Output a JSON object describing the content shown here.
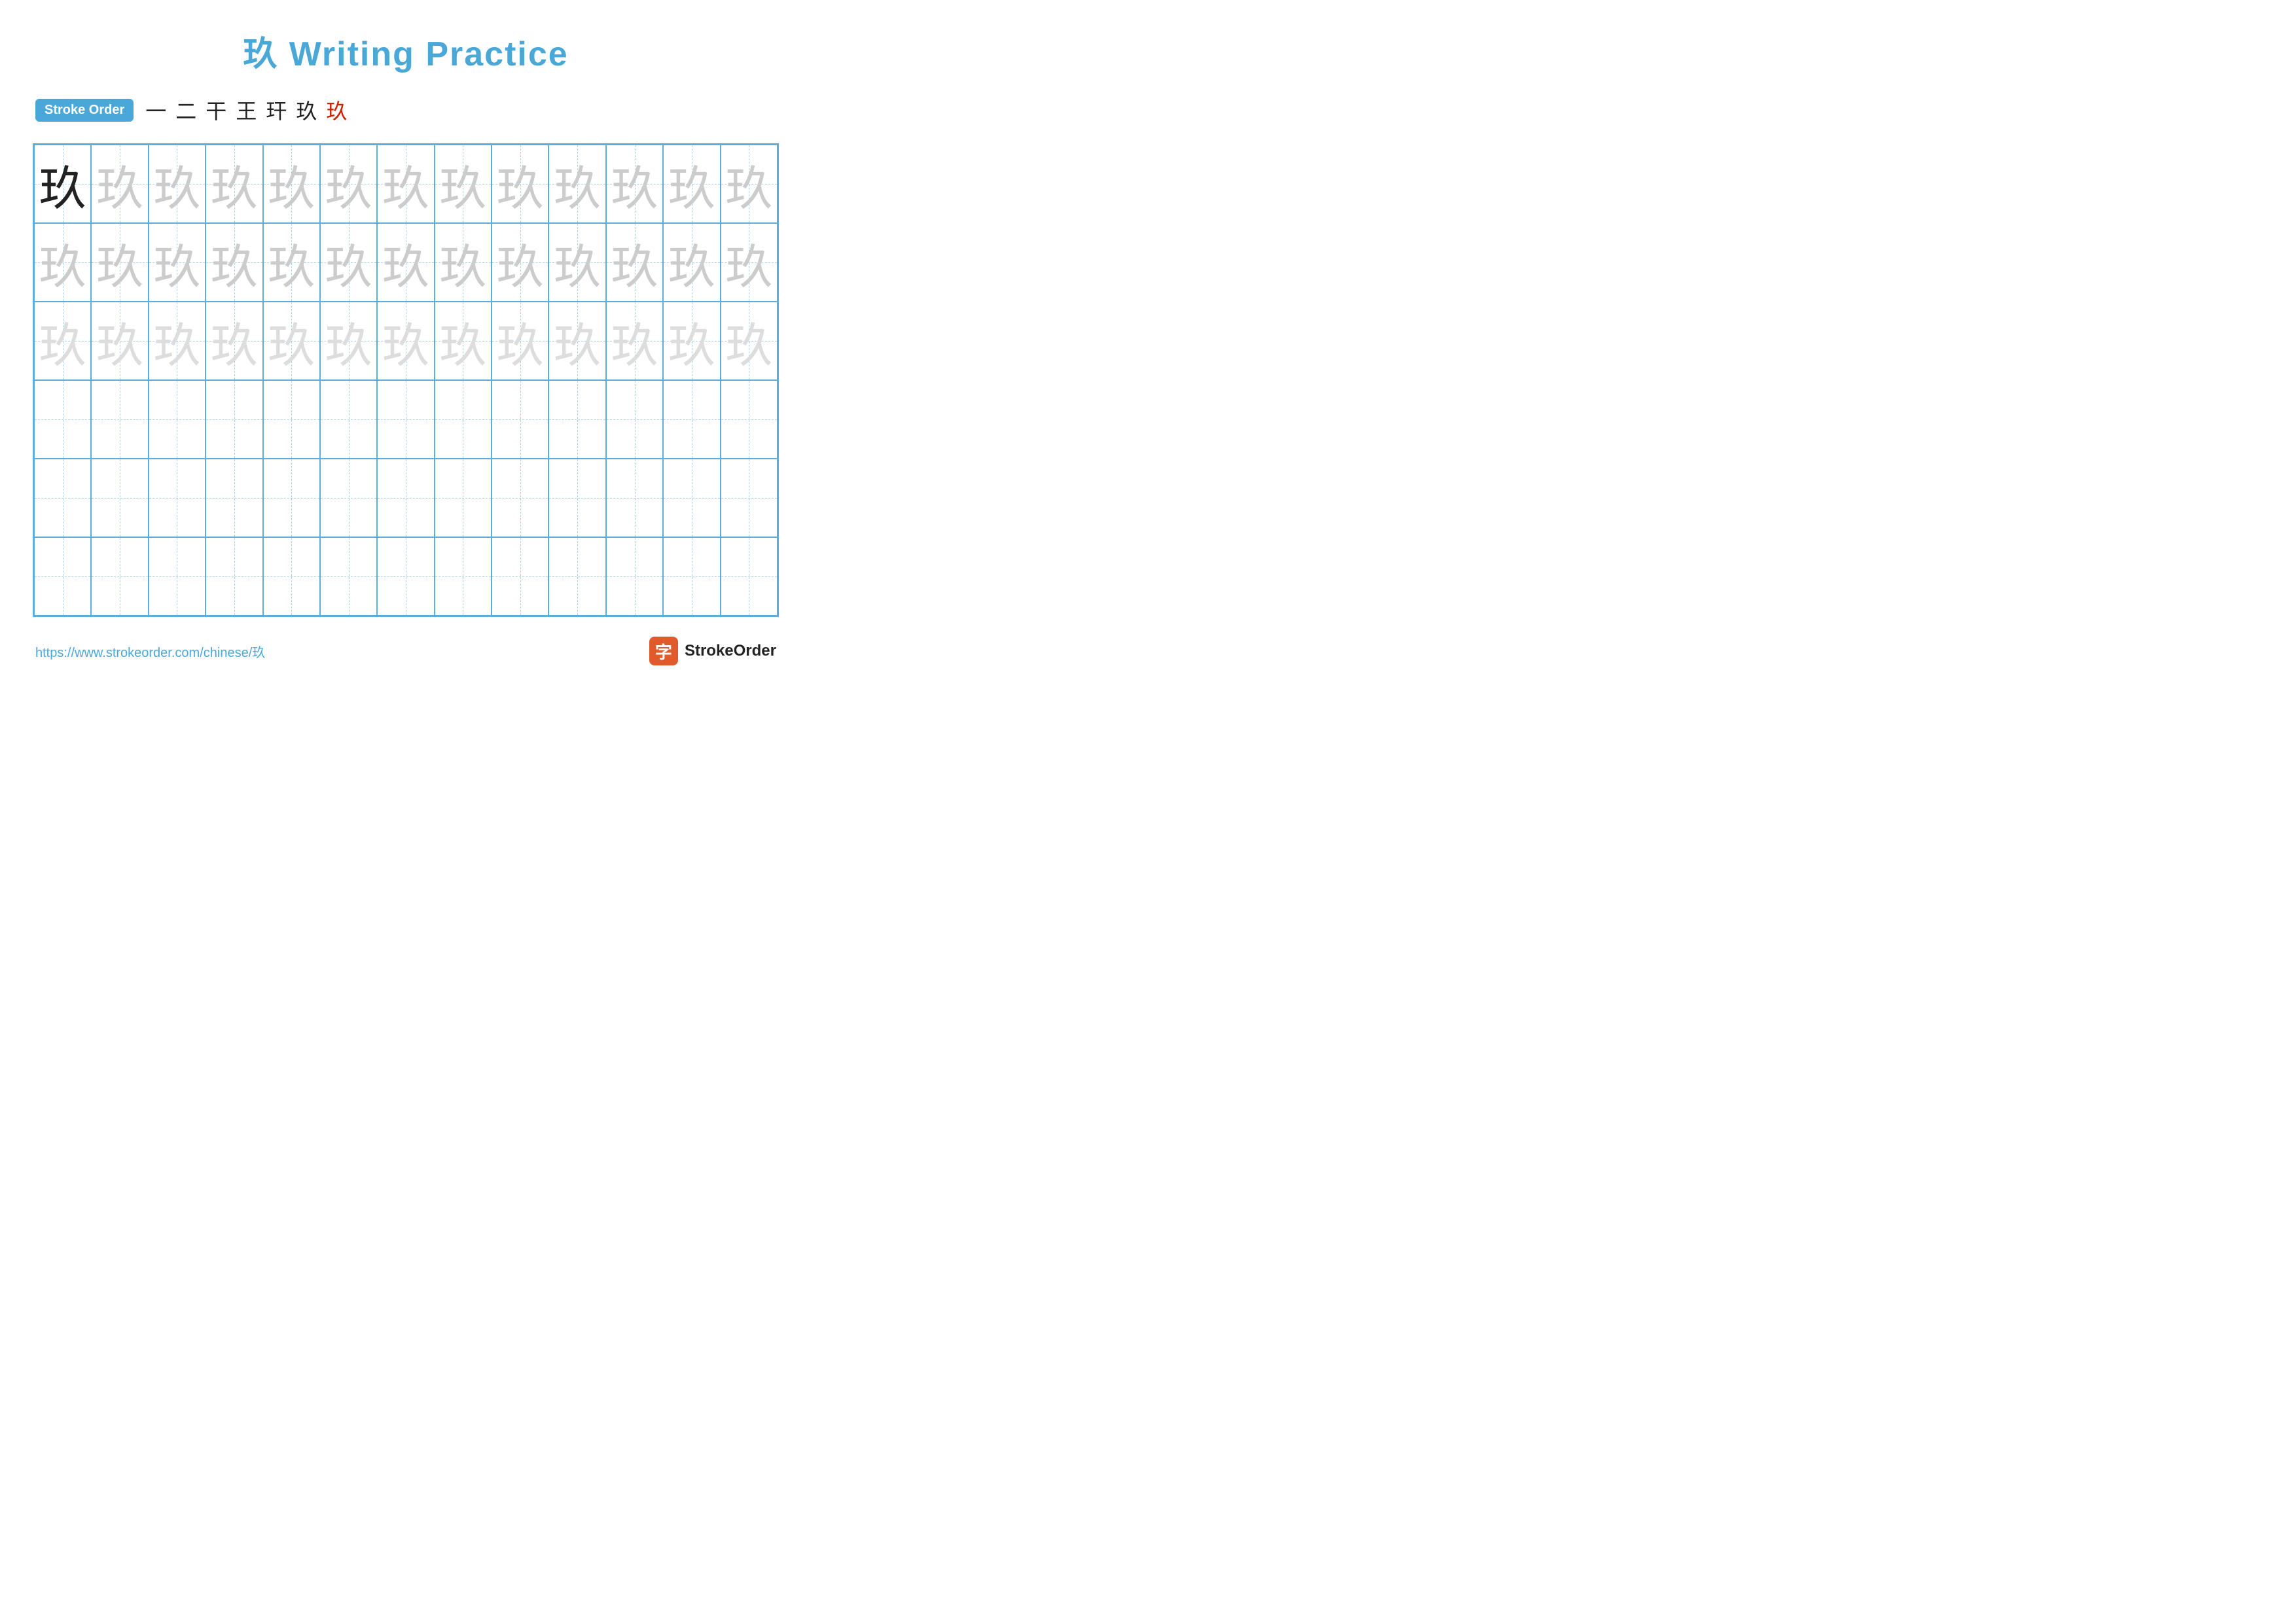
{
  "title": "玖 Writing Practice",
  "strokeOrder": {
    "badge": "Stroke Order",
    "chars": [
      "一",
      "二",
      "干",
      "王",
      "玕",
      "玖",
      "玖"
    ],
    "redIndex": 6
  },
  "grid": {
    "rows": 6,
    "cols": 13,
    "character": "玖",
    "rowTypes": [
      "dark-then-medium",
      "medium",
      "light",
      "empty",
      "empty",
      "empty"
    ]
  },
  "footer": {
    "url": "https://www.strokeorder.com/chinese/玖",
    "logoChar": "字",
    "logoText": "StrokeOrder"
  }
}
